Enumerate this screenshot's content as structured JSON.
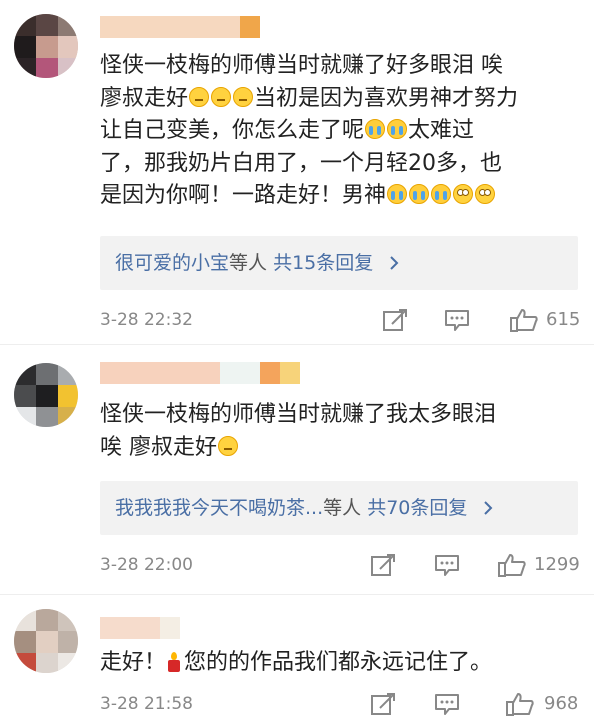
{
  "comments": [
    {
      "lines": [
        "怪侠一枝梅的师傅当时就赚了好多眼泪 唉",
        "廖叔走好",
        "当初是因为喜欢男神才努力",
        "让自己变美，你怎么走了呢",
        "太难过",
        "了，那我奶片白用了，一个月轻20多，也",
        "是因为你啊！一路走好！男神"
      ],
      "replies_user": "很可爱的小宝",
      "replies_suffix": "等人",
      "replies_count": "共15条回复",
      "time": "3-28 22:32",
      "likes": "615"
    },
    {
      "lines": [
        "怪侠一枝梅的师傅当时就赚了我太多眼泪",
        "唉 廖叔走好"
      ],
      "replies_user": "我我我我今天不喝奶茶...",
      "replies_suffix": "等人",
      "replies_count": "共70条回复",
      "time": "3-28 22:00",
      "likes": "1299"
    },
    {
      "lines": [
        "走好！",
        "您的的作品我们都永远记住了。"
      ],
      "time": "3-28 21:58",
      "likes": "968"
    }
  ],
  "icons": {
    "repost": "repost-icon",
    "comment": "comment-icon",
    "like": "thumbs-up-icon",
    "chevron": "chevron-right-icon"
  },
  "colors": {
    "link": "#4a6fa5",
    "meta": "#888888",
    "reply_bg": "#f2f2f2"
  }
}
